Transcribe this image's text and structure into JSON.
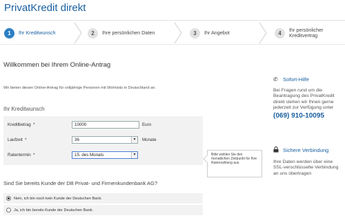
{
  "header": {
    "title": "PrivatKredit direkt"
  },
  "steps": [
    {
      "num": "1",
      "label": "Ihr Kreditwunsch",
      "active": true
    },
    {
      "num": "2",
      "label": "Ihre persönlichen Daten",
      "active": false
    },
    {
      "num": "3",
      "label": "Ihr Angebot",
      "active": false
    },
    {
      "num": "4",
      "label_line1": "Ihr persönlicher",
      "label_line2": "Kreditvertrag",
      "active": false
    }
  ],
  "main": {
    "welcome": "Willkommen bei Ihrem Online-Antrag",
    "intro": "Wir bieten diesen Online-Antrag für volljährige Personen mit Wohnsitz in Deutschland an.",
    "section_heading": "Ihr Kreditwunsch",
    "form": {
      "kreditbetrag": {
        "label": "Kreditbetrag",
        "required": "*",
        "value": "10000",
        "unit": "Euro"
      },
      "laufzeit": {
        "label": "Laufzeit",
        "required": "*",
        "value": "36",
        "unit": "Monate"
      },
      "ratentermin": {
        "label": "Ratentermin",
        "required": "*",
        "value": "15. des Monats"
      }
    },
    "tooltip": "Bitte wählen Sie den monatlichen Zeitpunkt für Ihre Ratenzahlung aus.",
    "question": "Sind Sie bereits Kunde der DB Privat- und Firmenkundenbank AG?",
    "radio_options": [
      {
        "label": "Nein, ich bin noch kein Kunde der Deutschen Bank.",
        "checked": true
      },
      {
        "label": "Ja, ich bin bereits Kunde der Deutschen Bank.",
        "checked": false
      }
    ]
  },
  "sidebar": {
    "hilfe": {
      "icon": "phone-icon",
      "title": "Sofort-Hilfe",
      "text": "Bei Fragen rund um die Beantragung des PrivatKredit direkt stehen wir Ihnen gerne jederzeit zur Verfügung unter",
      "phone": "(069) 910-10095"
    },
    "sicher": {
      "icon": "lock-icon",
      "title": "Sichere Verbindung",
      "text": "Ihre Daten werden über eine SSL-verschlüsselte Verbindung an uns übertragen"
    }
  },
  "colors": {
    "accent": "#1a5fa0",
    "step_active": "#2b7fc4",
    "form_bg": "#f2f2f2"
  }
}
